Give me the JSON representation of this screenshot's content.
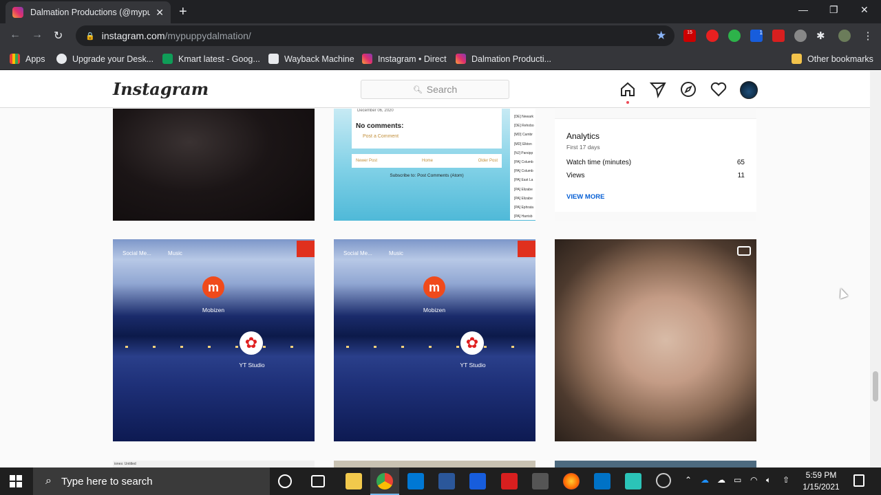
{
  "browser": {
    "tab_title": "Dalmation Productions (@mypup",
    "url_host": "instagram.com",
    "url_path": "/mypuppydalmation/",
    "ext_badge_abp": "15",
    "ext_badge_bw": "1"
  },
  "bookmarks": [
    {
      "label": "Apps"
    },
    {
      "label": "Upgrade your Desk..."
    },
    {
      "label": "Kmart latest - Goog..."
    },
    {
      "label": "Wayback Machine"
    },
    {
      "label": "Instagram • Direct"
    },
    {
      "label": "Dalmation Producti..."
    },
    {
      "label": "Other bookmarks"
    }
  ],
  "instagram": {
    "logo": "Instagram",
    "search_placeholder": "Search"
  },
  "posts": {
    "blog": {
      "date": "December 06, 2020",
      "no_comments": "No comments:",
      "post_comment": "Post a Comment",
      "newer": "Newer Post",
      "home": "Home",
      "older": "Older Post",
      "subscribe": "Subscribe to: Post Comments (Atom)",
      "sidebar": [
        "[DE] Newark",
        "[DE] Rehobo",
        "[MD] Cambr",
        "[MD] Elkton",
        "[NJ] Parsipp",
        "[PA] Columb",
        "[PA] Columb",
        "[PA] East La",
        "[PA] Elizabe",
        "[PA] Elizabe",
        "[PA] Ephrata",
        "[PA] Harrisb"
      ]
    },
    "analytics": {
      "title": "Analytics",
      "subtitle": "First 17 days",
      "rows": [
        {
          "label": "Watch time (minutes)",
          "value": "65"
        },
        {
          "label": "Views",
          "value": "11"
        }
      ],
      "view_more": "VIEW MORE"
    },
    "mobile": {
      "social": "Social Me...",
      "music": "Music",
      "mobizen": "Mobizen",
      "ytstudio": "YT Studio",
      "mz_letter": "m"
    },
    "bottom_left_caption": "iones: Untitled"
  },
  "taskbar": {
    "search_placeholder": "Type here to search",
    "time": "5:59 PM",
    "date": "1/15/2021"
  }
}
